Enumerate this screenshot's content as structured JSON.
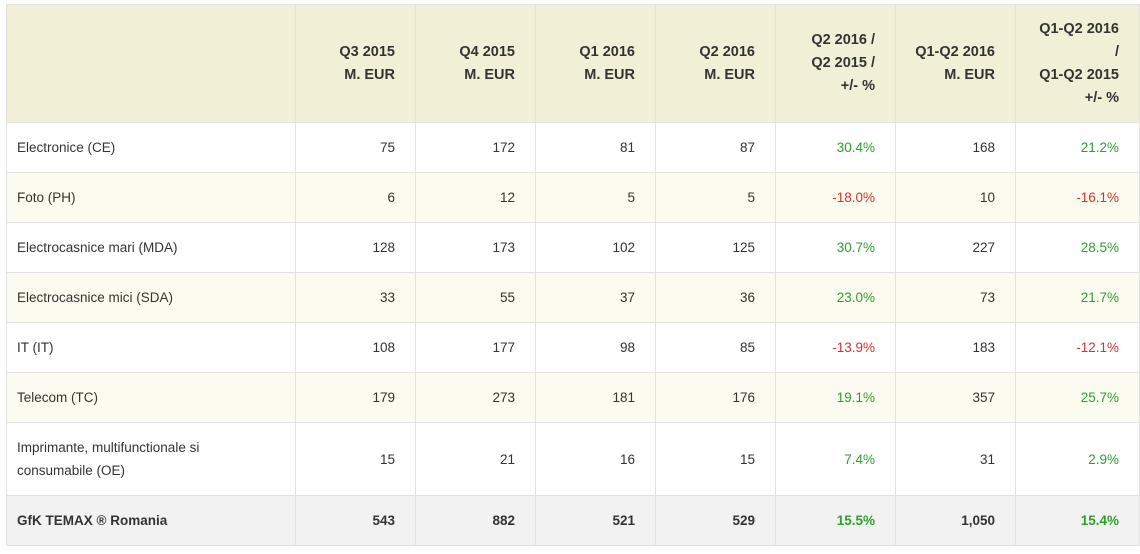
{
  "table": {
    "headers": [
      [
        "Q3 2015",
        "M. EUR"
      ],
      [
        "Q4 2015",
        "M. EUR"
      ],
      [
        "Q1 2016",
        "M. EUR"
      ],
      [
        "Q2 2016",
        "M. EUR"
      ],
      [
        "Q2 2016 /",
        "Q2 2015 /",
        "+/- %"
      ],
      [
        "Q1-Q2 2016",
        "M. EUR"
      ],
      [
        "Q1-Q2 2016",
        "/",
        "Q1-Q2 2015",
        "+/- %"
      ]
    ],
    "rows": [
      {
        "label": "Electronice (CE)",
        "q3_2015": "75",
        "q4_2015": "172",
        "q1_2016": "81",
        "q2_2016": "87",
        "q2_change": "30.4%",
        "q2_change_dir": "pos",
        "h1_2016": "168",
        "h1_change": "21.2%",
        "h1_change_dir": "pos"
      },
      {
        "label": "Foto (PH)",
        "q3_2015": "6",
        "q4_2015": "12",
        "q1_2016": "5",
        "q2_2016": "5",
        "q2_change": "-18.0%",
        "q2_change_dir": "neg",
        "h1_2016": "10",
        "h1_change": "-16.1%",
        "h1_change_dir": "neg"
      },
      {
        "label": "Electrocasnice mari (MDA)",
        "q3_2015": "128",
        "q4_2015": "173",
        "q1_2016": "102",
        "q2_2016": "125",
        "q2_change": "30.7%",
        "q2_change_dir": "pos",
        "h1_2016": "227",
        "h1_change": "28.5%",
        "h1_change_dir": "pos"
      },
      {
        "label": "Electrocasnice mici (SDA)",
        "q3_2015": "33",
        "q4_2015": "55",
        "q1_2016": "37",
        "q2_2016": "36",
        "q2_change": "23.0%",
        "q2_change_dir": "pos",
        "h1_2016": "73",
        "h1_change": "21.7%",
        "h1_change_dir": "pos"
      },
      {
        "label": "IT (IT)",
        "q3_2015": "108",
        "q4_2015": "177",
        "q1_2016": "98",
        "q2_2016": "85",
        "q2_change": "-13.9%",
        "q2_change_dir": "neg",
        "h1_2016": "183",
        "h1_change": "-12.1%",
        "h1_change_dir": "neg"
      },
      {
        "label": "Telecom (TC)",
        "q3_2015": "179",
        "q4_2015": "273",
        "q1_2016": "181",
        "q2_2016": "176",
        "q2_change": "19.1%",
        "q2_change_dir": "pos",
        "h1_2016": "357",
        "h1_change": "25.7%",
        "h1_change_dir": "pos"
      },
      {
        "label_lines": [
          "Imprimante, multifunctionale si",
          "consumabile (OE)"
        ],
        "q3_2015": "15",
        "q4_2015": "21",
        "q1_2016": "16",
        "q2_2016": "15",
        "q2_change": "7.4%",
        "q2_change_dir": "pos",
        "h1_2016": "31",
        "h1_change": "2.9%",
        "h1_change_dir": "pos"
      }
    ],
    "total": {
      "label": "GfK TEMAX ® Romania",
      "q3_2015": "543",
      "q4_2015": "882",
      "q1_2016": "521",
      "q2_2016": "529",
      "q2_change": "15.5%",
      "q2_change_dir": "pos",
      "h1_2016": "1,050",
      "h1_change": "15.4%",
      "h1_change_dir": "pos"
    }
  },
  "colors": {
    "header_bg": "#f1f0d6",
    "alt_row_bg": "#fbfbef",
    "total_bg": "#f2f2f2",
    "positive": "#2d9f2d",
    "negative": "#d9302c"
  }
}
